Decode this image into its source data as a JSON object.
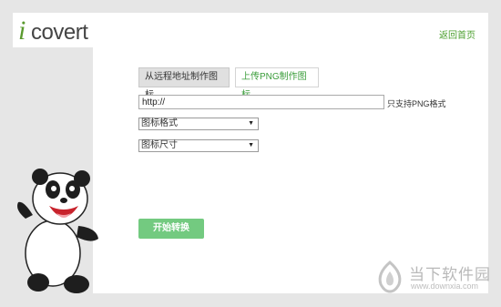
{
  "logo": {
    "letter": "i",
    "text": "covert"
  },
  "header": {
    "back_link": "返回首页"
  },
  "tabs": [
    {
      "label": "从远程地址制作图标",
      "active": true
    },
    {
      "label": "上传PNG制作图标",
      "active": false
    }
  ],
  "url_field": {
    "value": "http://",
    "hint": "只支持PNG格式"
  },
  "format_select": {
    "selected": "图标格式"
  },
  "size_select": {
    "selected": "图标尺寸"
  },
  "convert_button": {
    "label": "开始转换"
  },
  "watermark": {
    "name": "当下软件园",
    "url": "www.downxia.com"
  },
  "colors": {
    "accent_green": "#4b9f2e",
    "button_green": "#73ca80",
    "background": "#e6e6e6"
  },
  "icons": {
    "dropdown": "chevron-down-icon",
    "mascot": "panda-mascot",
    "watermark": "downxia-logo-icon"
  }
}
